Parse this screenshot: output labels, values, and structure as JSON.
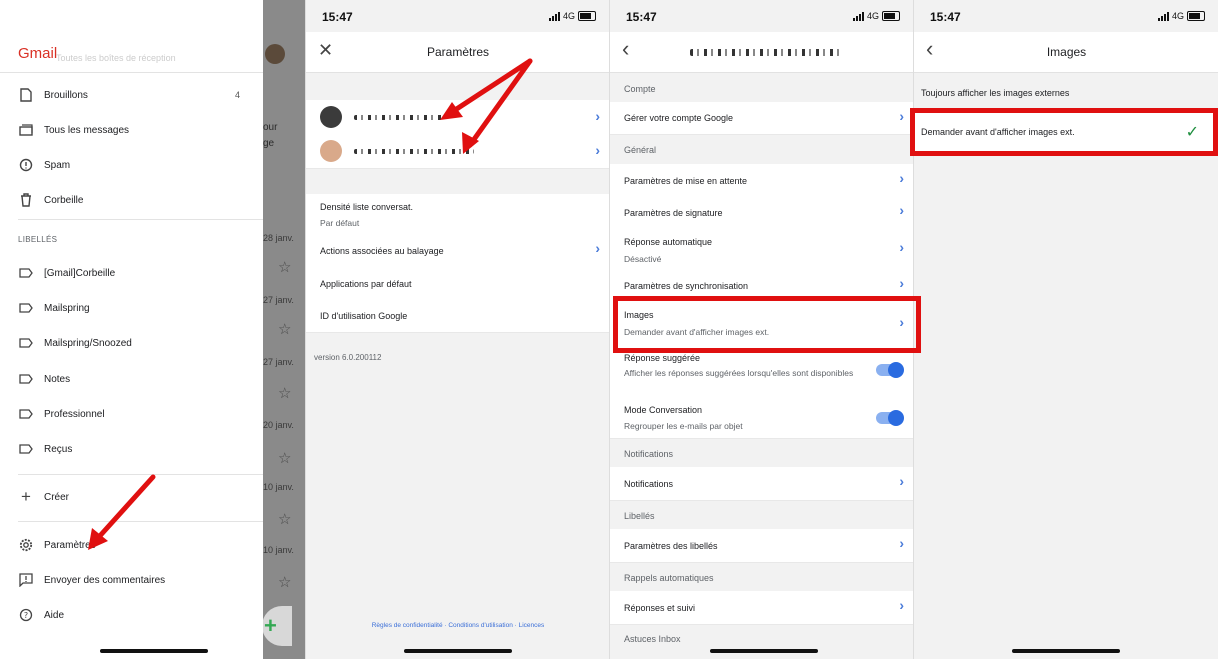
{
  "drawer": {
    "logo": "Gmail",
    "faded_text": "Toutes les boîtes de réception",
    "items": [
      {
        "label": "Brouillons",
        "count": "4"
      },
      {
        "label": "Tous les messages"
      },
      {
        "label": "Spam"
      },
      {
        "label": "Corbeille"
      }
    ],
    "labels_section": "LIBELLÉS",
    "labels": [
      "[Gmail]Corbeille",
      "Mailspring",
      "Mailspring/Snoozed",
      "Notes",
      "Professionnel",
      "Reçus"
    ],
    "create": "Créer",
    "settings": "Paramètres",
    "feedback": "Envoyer des commentaires",
    "help": "Aide",
    "bg_dates": [
      "28 janv.",
      "27 janv.",
      "27 janv.",
      "20 janv.",
      "10 janv.",
      "10 janv."
    ],
    "bg_words": [
      "our",
      "ge"
    ]
  },
  "status": {
    "time": "15:47",
    "network": "4G"
  },
  "settings_panel": {
    "title": "Paramètres",
    "density_title": "Densité liste conversat.",
    "density_value": "Par défaut",
    "swipe": "Actions associées au balayage",
    "default_apps": "Applications par défaut",
    "google_id": "ID d'utilisation Google",
    "version": "version 6.0.200112",
    "footer": "Règles de confidentialité · Conditions d'utilisation · Licences"
  },
  "account_panel": {
    "sec_account": "Compte",
    "manage": "Gérer votre compte Google",
    "sec_general": "Général",
    "snooze": "Paramètres de mise en attente",
    "signature": "Paramètres de signature",
    "auto_reply": "Réponse automatique",
    "auto_reply_value": "Désactivé",
    "sync": "Paramètres de synchronisation",
    "images": "Images",
    "images_value": "Demander avant d'afficher images ext.",
    "smart_reply": "Réponse suggérée",
    "smart_reply_desc": "Afficher les réponses suggérées lorsqu'elles sont disponibles",
    "conversation": "Mode Conversation",
    "conversation_desc": "Regrouper les e-mails par objet",
    "sec_notifications": "Notifications",
    "notifications": "Notifications",
    "sec_labels": "Libellés",
    "label_settings": "Paramètres des libellés",
    "sec_reminders": "Rappels automatiques",
    "reminders": "Réponses et suivi",
    "sec_inbox": "Astuces Inbox"
  },
  "images_panel": {
    "title": "Images",
    "option_always": "Toujours afficher les images externes",
    "option_ask": "Demander avant d'afficher images ext."
  },
  "colors": {
    "highlight": "#e01010",
    "link_blue": "#4a7bd9",
    "toggle_blue": "#2a6be0",
    "gmail_red": "#d93025"
  }
}
